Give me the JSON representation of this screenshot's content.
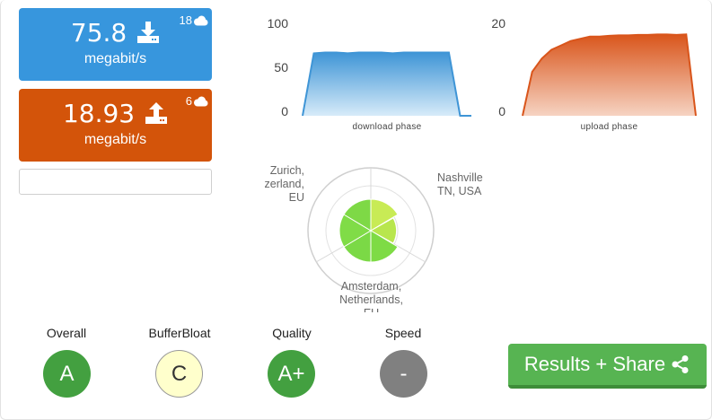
{
  "download": {
    "value": "75.8",
    "unit": "megabit/s",
    "server_count": "18",
    "color": "#3796dd",
    "icon": "download-icon"
  },
  "upload": {
    "value": "18.93",
    "unit": "megabit/s",
    "server_count": "6",
    "color": "#d3540a",
    "icon": "upload-icon"
  },
  "phases": {
    "download": {
      "label": "download phase",
      "ticks": [
        "100",
        "50",
        "0"
      ]
    },
    "upload": {
      "label": "upload phase",
      "ticks": [
        "20",
        "0"
      ]
    }
  },
  "chart_data": [
    {
      "type": "area",
      "xlabel": "download phase",
      "ylim": [
        0,
        100
      ],
      "color": "#3f95d6",
      "series": [
        {
          "values": [
            0,
            71,
            72,
            72,
            71,
            72,
            72,
            72,
            71,
            72,
            72,
            72,
            72,
            72,
            0,
            0
          ]
        }
      ]
    },
    {
      "type": "area",
      "xlabel": "upload phase",
      "ylim": [
        0,
        20
      ],
      "color": "#d9551b",
      "series": [
        {
          "values": [
            0,
            10,
            13,
            15,
            16,
            17,
            17.5,
            18,
            18,
            18.2,
            18.3,
            18.3,
            18.4,
            18.4,
            18.5,
            18.5,
            18.4,
            18.5,
            0
          ]
        }
      ]
    }
  ],
  "radar": {
    "servers": [
      {
        "lines": [
          "Zurich,",
          "zerland,",
          "EU"
        ]
      },
      {
        "lines": [
          "Nashville",
          "TN, USA"
        ]
      },
      {
        "lines": [
          "Amsterdam,",
          "Netherlands,",
          "EU"
        ]
      }
    ]
  },
  "grades": [
    {
      "title": "Overall",
      "grade": "A",
      "bg": "#43a040",
      "fg": "#ffffff"
    },
    {
      "title": "BufferBloat",
      "grade": "C",
      "bg": "#ffffcc",
      "fg": "#333333"
    },
    {
      "title": "Quality",
      "grade": "A+",
      "bg": "#43a040",
      "fg": "#ffffff"
    },
    {
      "title": "Speed",
      "grade": "-",
      "bg": "#808080",
      "fg": "#ffffff"
    }
  ],
  "share": {
    "label": "Results + Share",
    "icon": "share-icon"
  }
}
